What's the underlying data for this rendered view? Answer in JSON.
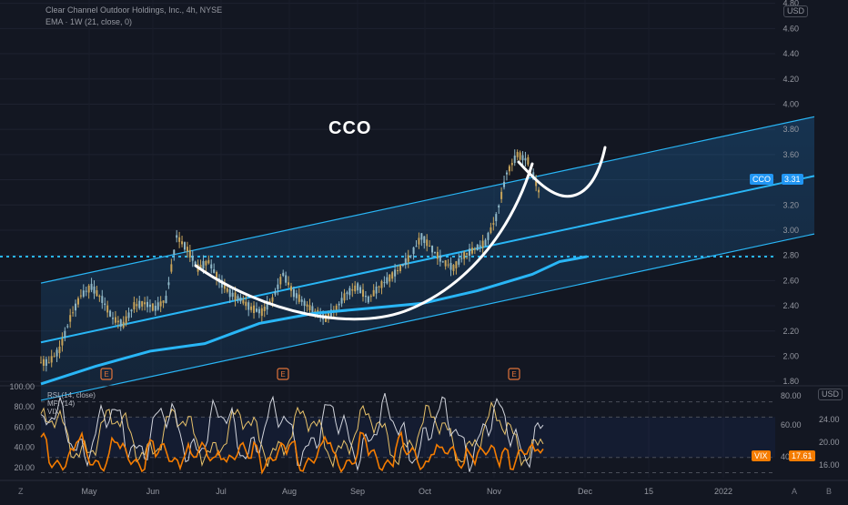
{
  "header": {
    "title": "Clear Channel Outdoor Holdings, Inc., 4h, NYSE",
    "indicator": "EMA · 1W (21, close, 0)"
  },
  "annotation": "CCO",
  "currency": "USD",
  "currency_lower": "USD",
  "price_badge": {
    "ticker": "CCO",
    "value": "3.31",
    "color": "#2196f3"
  },
  "vix_badge": {
    "ticker": "VIX",
    "value": "17.61",
    "color": "#f57c00"
  },
  "oscillator_legend": [
    "RSI (14, close)",
    "MFI (14)",
    "VIX"
  ],
  "earnings_marker": "E",
  "corners": {
    "bottom_left": "Z",
    "auto": "A",
    "log": "B"
  },
  "chart_data": {
    "type": "line",
    "price": {
      "ylim": [
        1.7,
        4.8
      ],
      "y_ticks": [
        "4.80",
        "4.60",
        "4.40",
        "4.20",
        "4.00",
        "3.80",
        "3.60",
        "3.40",
        "3.20",
        "3.00",
        "2.80",
        "2.60",
        "2.40",
        "2.20",
        "2.00",
        "1.80"
      ],
      "x_ticks": [
        "May",
        "Jun",
        "Jul",
        "Aug",
        "Sep",
        "Oct",
        "Nov",
        "Dec",
        "15",
        "2022"
      ],
      "last_price": 3.31,
      "horizontal_level": 2.79,
      "earnings_dates": [
        "May",
        "Aug",
        "Nov"
      ],
      "ema_1w": [
        [
          0,
          1.78
        ],
        [
          60,
          1.92
        ],
        [
          120,
          2.04
        ],
        [
          180,
          2.1
        ],
        [
          240,
          2.26
        ],
        [
          300,
          2.34
        ],
        [
          360,
          2.38
        ],
        [
          420,
          2.42
        ],
        [
          480,
          2.52
        ],
        [
          540,
          2.65
        ],
        [
          570,
          2.75
        ],
        [
          600,
          2.79
        ]
      ],
      "channel_upper": [
        [
          0,
          2.58
        ],
        [
          850,
          3.9
        ]
      ],
      "channel_mid": [
        [
          0,
          2.11
        ],
        [
          850,
          3.43
        ]
      ],
      "channel_lower": [
        [
          0,
          1.65
        ],
        [
          850,
          2.97
        ]
      ],
      "close_series": [
        1.95,
        2.05,
        2.3,
        2.48,
        2.55,
        2.45,
        2.3,
        2.25,
        2.4,
        2.42,
        2.38,
        2.45,
        2.95,
        2.85,
        2.7,
        2.75,
        2.6,
        2.5,
        2.45,
        2.38,
        2.35,
        2.45,
        2.65,
        2.5,
        2.42,
        2.35,
        2.3,
        2.38,
        2.5,
        2.55,
        2.45,
        2.55,
        2.62,
        2.7,
        2.8,
        2.95,
        2.85,
        2.75,
        2.7,
        2.8,
        2.85,
        2.9,
        3.1,
        3.45,
        3.6,
        3.55,
        3.31
      ]
    },
    "oscillator": {
      "ylim": [
        10,
        100
      ],
      "left_ticks": [
        "100.00",
        "80.00",
        "60.00",
        "40.00",
        "20.00"
      ],
      "right_ticks_outer": [
        "80.00",
        "60.00",
        "40.00"
      ],
      "right_ticks_inner": [
        "24.00",
        "20.00",
        "16.00"
      ],
      "levels": [
        70,
        30
      ],
      "series": [
        {
          "name": "RSI",
          "color": "#d1d4dc"
        },
        {
          "name": "MFI",
          "color": "#e8c26a"
        },
        {
          "name": "VIX",
          "color": "#f57c00"
        }
      ],
      "vix_last": 17.61
    }
  }
}
